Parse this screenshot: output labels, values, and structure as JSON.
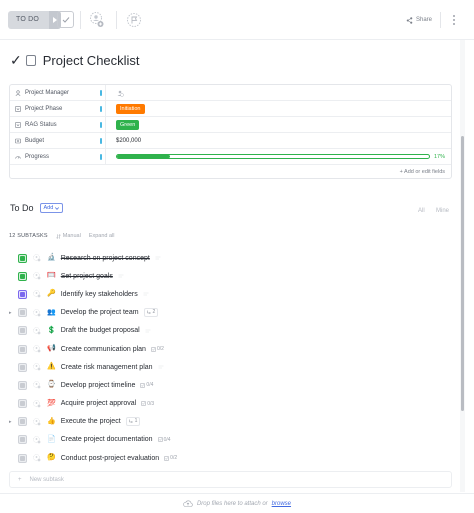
{
  "toolbar": {
    "status_label": "TO DO",
    "share_label": "Share"
  },
  "title": {
    "check_glyph": "✓",
    "text": "Project Checklist"
  },
  "fields": {
    "rows": [
      {
        "name": "Project Manager",
        "icon": "user-icon",
        "value": ""
      },
      {
        "name": "Project Phase",
        "icon": "dropdown-icon",
        "value": "Initiation",
        "badge_color": "#ff7a00"
      },
      {
        "name": "RAG Status",
        "icon": "dropdown-icon",
        "value": "Green",
        "badge_color": "#2fb24c"
      },
      {
        "name": "Budget",
        "icon": "money-icon",
        "value": "$200,000"
      },
      {
        "name": "Progress",
        "icon": "progress-icon",
        "value": "17%",
        "progress_fraction": 0.17
      }
    ],
    "add_label": "+ Add or edit fields"
  },
  "todo": {
    "title": "To Do",
    "add_label": "Add",
    "filter_all": "All",
    "filter_mine": "Mine"
  },
  "subtasks_header": {
    "count": "12 SUBTASKS",
    "manual": "Manual",
    "expand": "Expand all"
  },
  "subtasks": [
    {
      "label": "Research on project concept",
      "emoji": "🔬",
      "done": true,
      "box_color": "#2fb24c",
      "caret": false,
      "meta": ""
    },
    {
      "label": "Set project goals",
      "emoji": "🥅",
      "done": true,
      "box_color": "#2fb24c",
      "caret": false,
      "meta": ""
    },
    {
      "label": "Identify key stakeholders",
      "emoji": "🔑",
      "done": false,
      "box_color": "#7b68ee",
      "caret": false,
      "meta": ""
    },
    {
      "label": "Develop the project team",
      "emoji": "👥",
      "done": false,
      "box_color": "",
      "caret": true,
      "meta": "2"
    },
    {
      "label": "Draft the budget proposal",
      "emoji": "💲",
      "done": false,
      "box_color": "",
      "caret": false,
      "meta": ""
    },
    {
      "label": "Create communication plan",
      "emoji": "📢",
      "done": false,
      "box_color": "",
      "caret": false,
      "meta": "0/2"
    },
    {
      "label": "Create risk management plan",
      "emoji": "⚠️",
      "done": false,
      "box_color": "",
      "caret": false,
      "meta": ""
    },
    {
      "label": "Develop project timeline",
      "emoji": "⌚",
      "done": false,
      "box_color": "",
      "caret": false,
      "meta": "0/4"
    },
    {
      "label": "Acquire project approval",
      "emoji": "💯",
      "done": false,
      "box_color": "",
      "caret": false,
      "meta": "0/3"
    },
    {
      "label": "Execute the project",
      "emoji": "👍",
      "done": false,
      "box_color": "",
      "caret": true,
      "meta": "1"
    },
    {
      "label": "Create project documentation",
      "emoji": "📄",
      "done": false,
      "box_color": "",
      "caret": false,
      "meta": "0/4"
    },
    {
      "label": "Conduct post-project evaluation",
      "emoji": "🤔",
      "done": false,
      "box_color": "",
      "caret": false,
      "meta": "0/2"
    }
  ],
  "new_subtask": {
    "plus": "+",
    "placeholder": "New subtask"
  },
  "dropzone": {
    "text": "Drop files here to attach or",
    "link": "browse"
  }
}
